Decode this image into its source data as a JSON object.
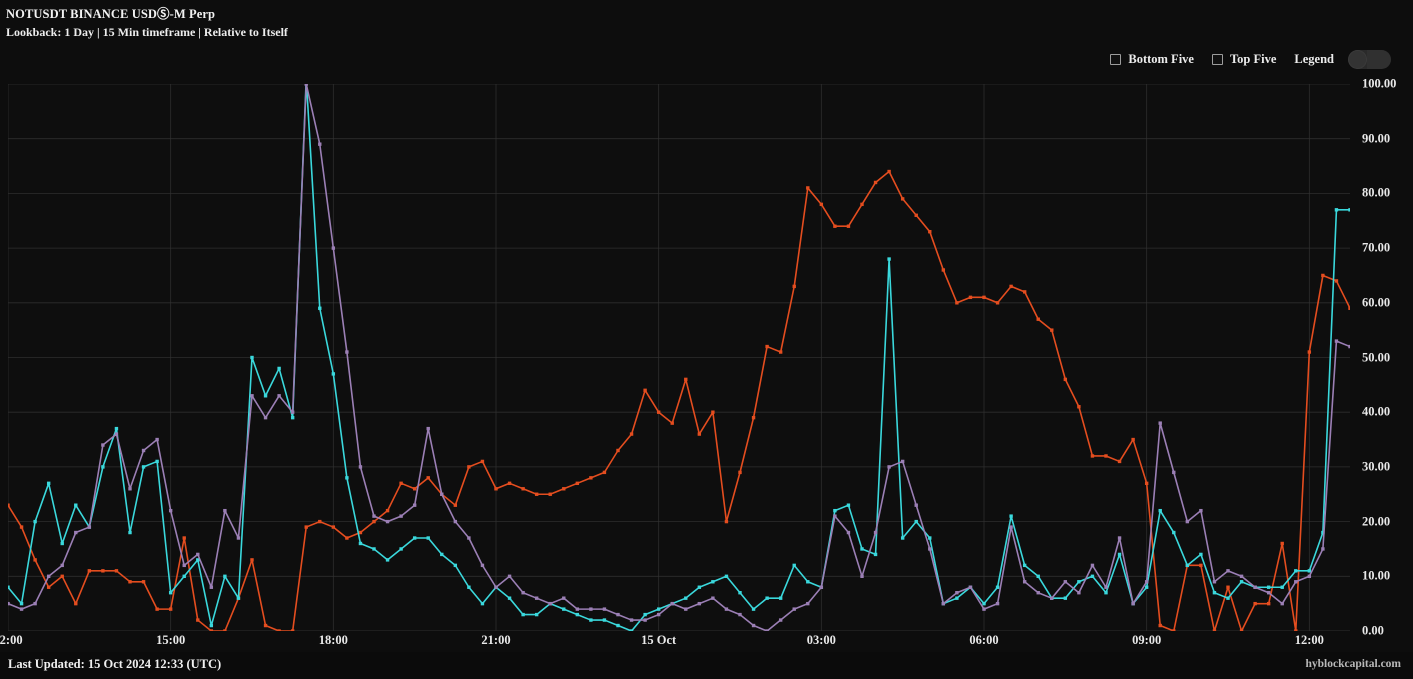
{
  "header": {
    "title": "NOTUSDT BINANCE USDⓈ-M Perp",
    "subtitle": "Lookback: 1 Day | 15 Min timeframe | Relative to Itself"
  },
  "controls": {
    "bottom_five_label": "Bottom Five",
    "bottom_five_checked": false,
    "top_five_label": "Top Five",
    "top_five_checked": false,
    "legend_label": "Legend",
    "legend_toggle_on": false
  },
  "footer": {
    "last_updated": "Last Updated: 15 Oct 2024 12:33 (UTC)",
    "watermark": "hyblockcapital.com"
  },
  "colors": {
    "background": "#0d0d0d",
    "plot_background": "#0e0e0e",
    "grid": "#333333",
    "series_orange": "#e44d1f",
    "series_cyan": "#3ad8dc",
    "series_purple": "#9b7fb5",
    "text": "#ececec"
  },
  "chart_data": {
    "type": "line",
    "title": "NOTUSDT BINANCE USDⓈ-M Perp",
    "subtitle": "Lookback: 1 Day | 15 Min timeframe | Relative to Itself",
    "xlabel": "",
    "ylabel": "",
    "ylim": [
      0,
      100
    ],
    "yticks": [
      0,
      10,
      20,
      30,
      40,
      50,
      60,
      70,
      80,
      90,
      100
    ],
    "ytick_labels": [
      "0.00",
      "10.00",
      "20.00",
      "30.00",
      "40.00",
      "50.00",
      "60.00",
      "70.00",
      "80.00",
      "90.00",
      "100.00"
    ],
    "xtick_labels": [
      "12:00",
      "15:00",
      "18:00",
      "21:00",
      "15 Oct",
      "03:00",
      "06:00",
      "09:00",
      "12:00"
    ],
    "xtick_positions": [
      0,
      12,
      24,
      36,
      48,
      60,
      72,
      84,
      96
    ],
    "x_count": 97,
    "grid": true,
    "legend_position": "hidden",
    "markers": true,
    "series": [
      {
        "name": "orange",
        "color": "#e44d1f",
        "values": [
          23,
          19,
          13,
          8,
          10,
          5,
          11,
          11,
          11,
          9,
          9,
          4,
          4,
          17,
          2,
          0,
          0,
          6,
          13,
          1,
          0,
          0,
          19,
          20,
          19,
          17,
          18,
          20,
          22,
          27,
          26,
          28,
          25,
          23,
          30,
          31,
          26,
          27,
          26,
          25,
          25,
          26,
          27,
          28,
          29,
          33,
          36,
          44,
          40,
          38,
          46,
          36,
          40,
          20,
          29,
          39,
          52,
          51,
          63,
          81,
          78,
          74,
          74,
          78,
          82,
          84,
          79,
          76,
          73,
          66,
          60,
          61,
          61,
          60,
          63,
          62,
          57,
          55,
          46,
          41,
          32,
          32,
          31,
          35,
          27,
          1,
          0,
          12,
          12,
          0,
          8,
          0,
          5,
          5,
          16,
          0,
          51,
          65,
          64,
          59
        ],
        "label": "orange series"
      },
      {
        "name": "cyan",
        "color": "#3ad8dc",
        "values": [
          8,
          5,
          20,
          27,
          16,
          23,
          19,
          30,
          37,
          18,
          30,
          31,
          7,
          10,
          13,
          1,
          10,
          6,
          50,
          43,
          48,
          39,
          101,
          59,
          47,
          28,
          16,
          15,
          13,
          15,
          17,
          17,
          14,
          12,
          8,
          5,
          8,
          6,
          3,
          3,
          5,
          4,
          3,
          2,
          2,
          1,
          0,
          3,
          4,
          5,
          6,
          8,
          9,
          10,
          7,
          4,
          6,
          6,
          12,
          9,
          8,
          22,
          23,
          15,
          14,
          68,
          17,
          20,
          17,
          5,
          6,
          8,
          5,
          8,
          21,
          12,
          10,
          6,
          6,
          9,
          10,
          7,
          14,
          5,
          8,
          22,
          18,
          12,
          14,
          7,
          6,
          9,
          8,
          8,
          8,
          11,
          11,
          18,
          77,
          77
        ],
        "label": "cyan series"
      },
      {
        "name": "purple",
        "color": "#9b7fb5",
        "values": [
          5,
          4,
          5,
          10,
          12,
          18,
          19,
          34,
          36,
          26,
          33,
          35,
          22,
          12,
          14,
          8,
          22,
          17,
          43,
          39,
          43,
          40,
          100,
          89,
          70,
          51,
          30,
          21,
          20,
          21,
          23,
          37,
          25,
          20,
          17,
          12,
          8,
          10,
          7,
          6,
          5,
          6,
          4,
          4,
          4,
          3,
          2,
          2,
          3,
          5,
          4,
          5,
          6,
          4,
          3,
          1,
          0,
          2,
          4,
          5,
          8,
          21,
          18,
          10,
          18,
          30,
          31,
          23,
          15,
          5,
          7,
          8,
          4,
          5,
          19,
          9,
          7,
          6,
          9,
          7,
          12,
          8,
          17,
          5,
          9,
          38,
          29,
          20,
          22,
          9,
          11,
          10,
          8,
          7,
          5,
          9,
          10,
          15,
          53,
          52
        ],
        "label": "purple series"
      }
    ]
  }
}
